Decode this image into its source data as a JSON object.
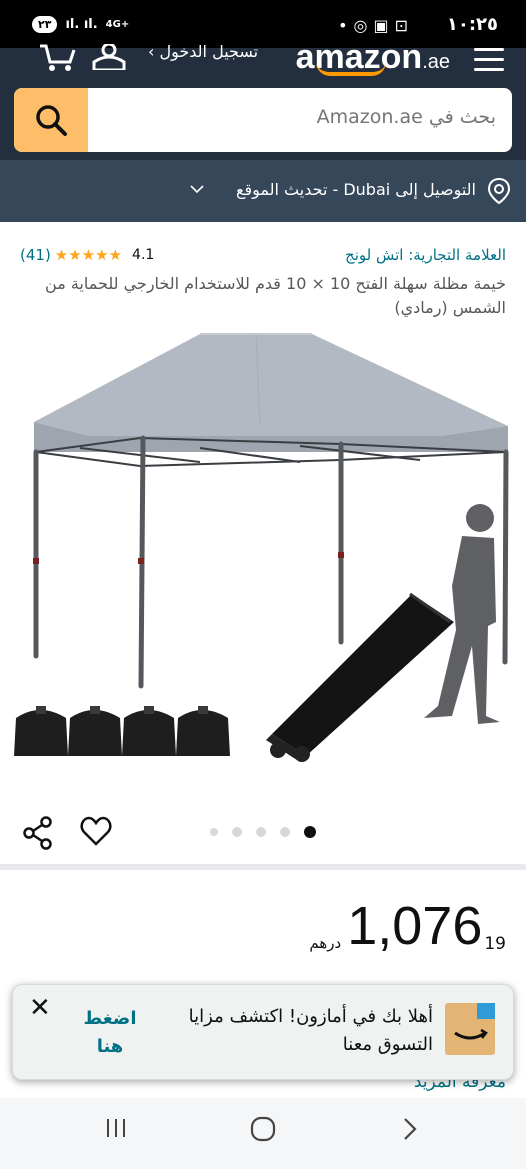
{
  "status_bar": {
    "time": "١٠:٢٥",
    "notification_badge": "٢٣",
    "network": "4G+",
    "icons": [
      "dot",
      "whatsapp-icon",
      "instagram-icon",
      "screen-icon"
    ]
  },
  "header": {
    "logo_text": "amazon",
    "logo_suffix": ".ae",
    "signin_label": "تسجيل الدخول ›",
    "search_placeholder": "بحث في Amazon.ae",
    "deliver_text": "التوصيل إلى Dubai - تحديث الموقع"
  },
  "product": {
    "brand": "العلامة التجارية: اتش لونج",
    "rating_value": "4.1",
    "stars": "★★★★★",
    "rating_count": "(41)",
    "title": "خيمة مظلة سهلة الفتح 10 × 10 قدم للاستخدام الخارجي للحماية من الشمس (رمادي)",
    "image_dots": 5,
    "active_dot": 4
  },
  "price": {
    "currency": "درهم",
    "whole": "1,076",
    "fraction": "19"
  },
  "learn_more": "معرفة المزيد",
  "toast": {
    "message": "أهلا بك في أمازون! اكتشف مزايا التسوق معنا",
    "action": "اضغط هنا",
    "close": "✕"
  },
  "colors": {
    "header_bg": "#232f3e",
    "deliver_bg": "#37475a",
    "search_button": "#febd69",
    "link": "#007185",
    "star": "#ffa41c"
  }
}
